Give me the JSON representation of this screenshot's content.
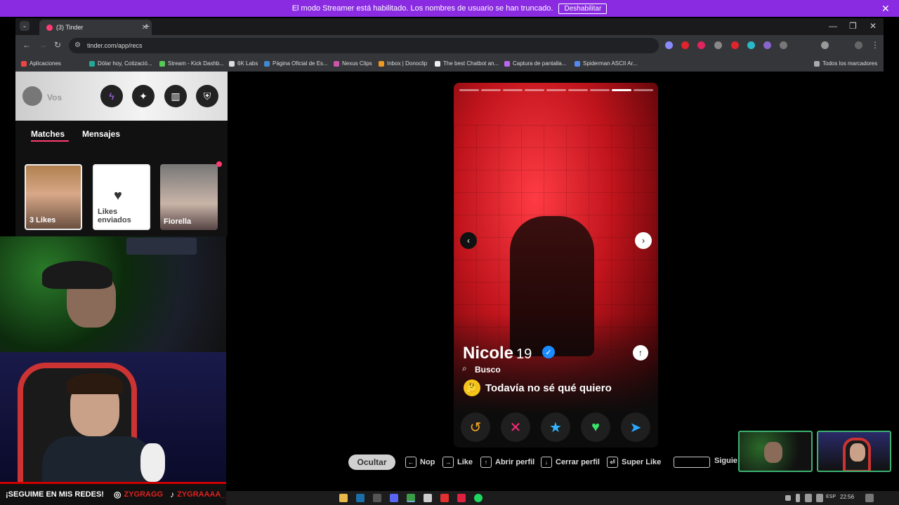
{
  "banner": {
    "message": "El modo Streamer está habilitado. Los nombres de usuario se han truncado.",
    "disable_label": "Deshabilitar",
    "close_icon": "✕"
  },
  "browser": {
    "tab_title": "(3) Tinder",
    "url": "tinder.com/app/recs",
    "bookmarks": [
      "Aplicaciones",
      "Dólar hoy, Cotizació...",
      "Stream - Kick Dashb...",
      "6K Labs",
      "Página Oficial de Es...",
      "Nexus Clips",
      "Inbox | Donoclip",
      "The best Chatbot an...",
      "Captura de pantalla...",
      "Spiderman ASCII Ar..."
    ],
    "bookmarks_all": "Todos los marcadores"
  },
  "sidebar": {
    "user_label": "Vos",
    "tabs": [
      "Matches",
      "Mensajes"
    ],
    "cards": [
      {
        "label": "3 Likes"
      },
      {
        "label": "Likes enviados"
      },
      {
        "label": "Fiorella"
      }
    ]
  },
  "profile": {
    "name": "Nicole",
    "age": "19",
    "busco_label": "Busco",
    "looking_for": "Todavía no sé qué quiero",
    "looking_emoji": "🤔",
    "photo_count": 9,
    "active_photo": 8
  },
  "actions": [
    {
      "name": "rewind-icon",
      "glyph": "↺",
      "color": "#f5a623"
    },
    {
      "name": "nope-icon",
      "glyph": "✕",
      "color": "#ff2d7a"
    },
    {
      "name": "super-like-icon",
      "glyph": "★",
      "color": "#33b5ff"
    },
    {
      "name": "like-icon",
      "glyph": "♥",
      "color": "#39e36a"
    },
    {
      "name": "boost-icon",
      "glyph": "➤",
      "color": "#29a8ff"
    }
  ],
  "shortcuts": {
    "hide_label": "Ocultar",
    "items": [
      {
        "key": "←",
        "label": "Nop"
      },
      {
        "key": "→",
        "label": "Like"
      },
      {
        "key": "↑",
        "label": "Abrir perfil"
      },
      {
        "key": "↓",
        "label": "Cerrar perfil"
      },
      {
        "key": "⏎",
        "label": "Super Like"
      },
      {
        "key": "",
        "label": "Siguie"
      }
    ]
  },
  "social": {
    "follow_text": "¡SEGUIME EN MIS REDES!",
    "instagram": "ZYGRAGG",
    "tiktok": "ZYGRAAAA_"
  },
  "taskbar": {
    "lang": "ESP",
    "time": "22:56"
  }
}
